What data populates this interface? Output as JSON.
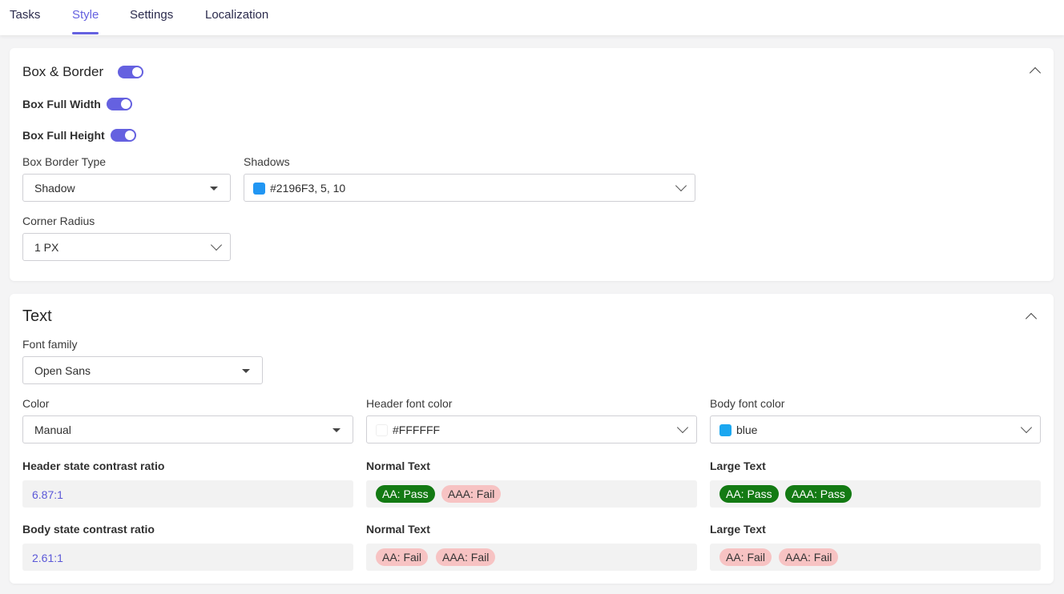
{
  "tabs": [
    {
      "label": "Tasks",
      "active": false
    },
    {
      "label": "Style",
      "active": true
    },
    {
      "label": "Settings",
      "active": false
    },
    {
      "label": "Localization",
      "active": false
    }
  ],
  "box_border": {
    "title": "Box & Border",
    "enabled": true,
    "full_width_label": "Box Full Width",
    "full_width_enabled": true,
    "full_height_label": "Box Full Height",
    "full_height_enabled": true,
    "border_type_label": "Box Border Type",
    "border_type_value": "Shadow",
    "shadows_label": "Shadows",
    "shadows_value": "#2196F3, 5, 10",
    "shadows_color": "#2196F3",
    "corner_radius_label": "Corner Radius",
    "corner_radius_value": "1 PX"
  },
  "text_section": {
    "title": "Text",
    "font_family_label": "Font family",
    "font_family_value": "Open Sans",
    "color_label": "Color",
    "color_value": "Manual",
    "header_font_color_label": "Header font color",
    "header_font_color_value": "#FFFFFF",
    "header_font_swatch": "#FFFFFF",
    "body_font_color_label": "Body font color",
    "body_font_color_value": "blue",
    "body_font_swatch": "#1ba7f0",
    "header_contrast_label": "Header state contrast ratio",
    "header_contrast_value": "6.87:1",
    "header_normal_label": "Normal Text",
    "header_normal_aa": "AA: Pass",
    "header_normal_aaa": "AAA: Fail",
    "header_large_label": "Large Text",
    "header_large_aa": "AA: Pass",
    "header_large_aaa": "AAA: Pass",
    "body_contrast_label": "Body state contrast ratio",
    "body_contrast_value": "2.61:1",
    "body_normal_label": "Normal Text",
    "body_normal_aa": "AA: Fail",
    "body_normal_aaa": "AAA: Fail",
    "body_large_label": "Large Text",
    "body_large_aa": "AA: Fail",
    "body_large_aaa": "AAA: Fail"
  },
  "colors": {
    "accent": "#6561e0",
    "pass": "#137a13",
    "fail": "#f7c3c3"
  }
}
